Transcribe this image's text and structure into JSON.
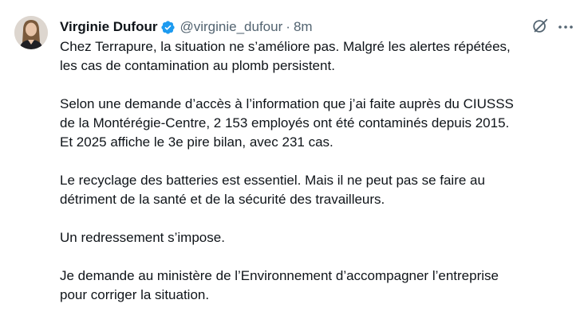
{
  "author": {
    "name": "Virginie Dufour",
    "handle": "@virginie_dufour",
    "separator": "·",
    "time": "8m"
  },
  "icons": {
    "verified": "verified-badge-icon",
    "grok": "grok-icon",
    "more": "more-icon"
  },
  "colors": {
    "verified_blue": "#1d9bf0",
    "text": "#0f1419",
    "secondary": "#536471"
  },
  "paragraphs": [
    {
      "lines": [
        "Chez Terrapure, la situation ne s’améliore pas. Malgré les alertes répétées,",
        "les cas de contamination au plomb persistent."
      ]
    },
    {
      "lines": [
        "Selon une demande d’accès à l’information que j’ai faite auprès du CIUSSS",
        "de la Montérégie-Centre, 2 153 employés ont été contaminés depuis 2015.",
        "Et 2025 affiche le 3e pire bilan, avec 231 cas."
      ]
    },
    {
      "lines": [
        "Le recyclage des batteries est essentiel. Mais il ne peut pas se faire au",
        "détriment de la santé et de la sécurité des travailleurs."
      ]
    },
    {
      "lines": [
        "Un redressement s’impose."
      ]
    },
    {
      "lines": [
        "Je demande au ministère de l’Environnement d’accompagner l’entreprise",
        "pour corriger la situation."
      ]
    }
  ]
}
